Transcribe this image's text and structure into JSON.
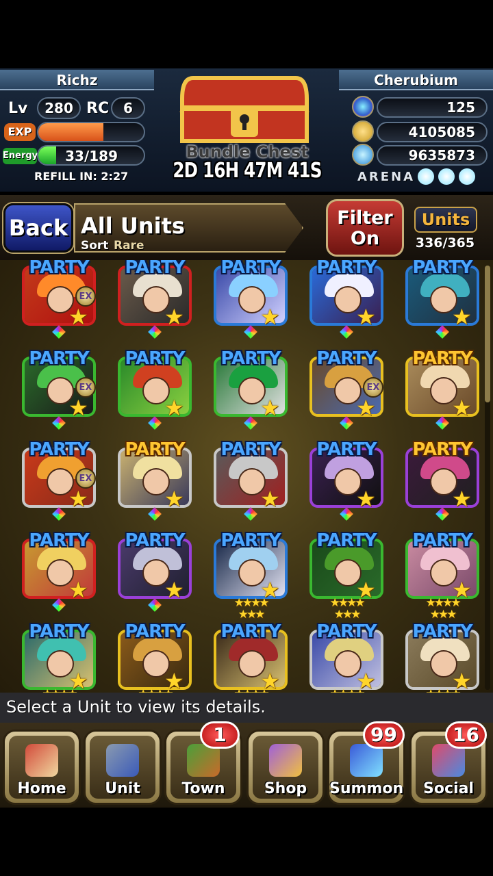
{
  "player": {
    "name": "Richz",
    "lv_label": "Lv",
    "level": "280",
    "rc_label": "RC",
    "rc": "6",
    "exp_label": "EXP",
    "exp_fraction": 0.62,
    "energy_label": "Energy",
    "energy": "33/189",
    "energy_fraction": 0.17,
    "refill": "REFILL IN: 2:27"
  },
  "rival": {
    "name": "Cherubium"
  },
  "currency": {
    "gems": "125",
    "zel": "4105085",
    "karma": "9635873",
    "arena_label": "ARENA",
    "arena_orbs": 3
  },
  "chest": {
    "label": "Bundle Chest",
    "timer": "2D 16H 47M 41S"
  },
  "toolbar": {
    "back": "Back",
    "title": "All Units",
    "sort_label": "Sort",
    "sort_value": "Rare",
    "filter_line1": "Filter",
    "filter_line2": "On",
    "units_label": "Units",
    "units_count": "336/365"
  },
  "grid": {
    "party_label": "PARTY",
    "units": [
      {
        "party": "blue",
        "frame": "#d02020",
        "ex": true,
        "gem": true,
        "palette": [
          "#c23a1a",
          "#ff8a2a",
          "#b01010"
        ]
      },
      {
        "party": "blue",
        "frame": "#d02020",
        "ex": false,
        "gem": true,
        "palette": [
          "#6a5a4a",
          "#e8e0d0",
          "#2a2a2a"
        ]
      },
      {
        "party": "blue",
        "frame": "#2a7ad8",
        "ex": false,
        "gem": true,
        "palette": [
          "#3a4aa8",
          "#8ad0ff",
          "#d0d0ff"
        ]
      },
      {
        "party": "blue",
        "frame": "#2a7ad8",
        "ex": false,
        "gem": true,
        "palette": [
          "#2a6ad8",
          "#f0f0ff",
          "#3a2050"
        ]
      },
      {
        "party": "blue",
        "frame": "#2a7ad8",
        "ex": false,
        "gem": true,
        "palette": [
          "#1a5a7a",
          "#40b0c0",
          "#203040"
        ]
      },
      {
        "party": "blue",
        "frame": "#3ab830",
        "ex": true,
        "gem": true,
        "palette": [
          "#2a6a2a",
          "#4ac04a",
          "#1a1a1a"
        ]
      },
      {
        "party": "blue",
        "frame": "#3ab830",
        "ex": false,
        "gem": true,
        "palette": [
          "#2a8a2a",
          "#d04020",
          "#8ad040"
        ]
      },
      {
        "party": "blue",
        "frame": "#3ab830",
        "ex": false,
        "gem": true,
        "palette": [
          "#2a7a3a",
          "#1aa040",
          "#e0e0e0"
        ]
      },
      {
        "party": "blue",
        "frame": "#e8c020",
        "ex": true,
        "gem": true,
        "palette": [
          "#6a4a2a",
          "#d8a040",
          "#4a6ab0"
        ]
      },
      {
        "party": "gold",
        "frame": "#e8c020",
        "ex": false,
        "gem": true,
        "palette": [
          "#a88a5a",
          "#f0d8b0",
          "#6a4a2a"
        ]
      },
      {
        "party": "blue",
        "frame": "#c8c8c8",
        "ex": true,
        "gem": true,
        "palette": [
          "#c83a1a",
          "#f0a030",
          "#8a2a1a"
        ]
      },
      {
        "party": "gold",
        "frame": "#c8c8c8",
        "ex": false,
        "gem": true,
        "palette": [
          "#c8b070",
          "#f0e0a0",
          "#3a3a5a"
        ]
      },
      {
        "party": "blue",
        "frame": "#c8c8c8",
        "ex": false,
        "gem": true,
        "palette": [
          "#5a5a5a",
          "#c8c8c8",
          "#a02020"
        ]
      },
      {
        "party": "blue",
        "frame": "#9a40d8",
        "ex": false,
        "gem": true,
        "palette": [
          "#3a2050",
          "#c0a0e0",
          "#101010"
        ]
      },
      {
        "party": "gold",
        "frame": "#9a40d8",
        "ex": false,
        "gem": true,
        "palette": [
          "#3a1a3a",
          "#d04a8a",
          "#202020"
        ]
      },
      {
        "party": "blue",
        "frame": "#d02020",
        "ex": false,
        "gem": true,
        "palette": [
          "#c89a30",
          "#f0d060",
          "#c03a3a"
        ]
      },
      {
        "party": "blue",
        "frame": "#9a40d8",
        "ex": false,
        "gem": true,
        "palette": [
          "#4a3a6a",
          "#c0c0d8",
          "#202030"
        ]
      },
      {
        "party": "blue",
        "frame": "#2a7ad8",
        "ex": false,
        "gem": false,
        "palette": [
          "#1a2a4a",
          "#a0d0f0",
          "#e0e0f0"
        ]
      },
      {
        "party": "blue",
        "frame": "#3ab830",
        "ex": false,
        "gem": false,
        "palette": [
          "#1a4a1a",
          "#4a9a2a",
          "#2a6a2a"
        ]
      },
      {
        "party": "blue",
        "frame": "#3ab830",
        "ex": false,
        "gem": false,
        "palette": [
          "#c88aa0",
          "#f0c0d0",
          "#7a4a6a"
        ]
      },
      {
        "party": "blue",
        "frame": "#3ab830",
        "ex": false,
        "gem": false,
        "palette": [
          "#2a6a6a",
          "#40c0b0",
          "#d8c070"
        ]
      },
      {
        "party": "blue",
        "frame": "#e8c020",
        "ex": false,
        "gem": false,
        "palette": [
          "#8a5a1a",
          "#d8a040",
          "#3a2a10"
        ]
      },
      {
        "party": "blue",
        "frame": "#e8c020",
        "ex": false,
        "gem": false,
        "palette": [
          "#3a2a1a",
          "#a02a2a",
          "#d8c070"
        ]
      },
      {
        "party": "blue",
        "frame": "#c8c8c8",
        "ex": false,
        "gem": false,
        "palette": [
          "#3a4aa8",
          "#e0d080",
          "#c0c0e0"
        ]
      },
      {
        "party": "blue",
        "frame": "#c8c8c8",
        "ex": false,
        "gem": false,
        "palette": [
          "#8a7a5a",
          "#f0e0c0",
          "#5a4a2a"
        ]
      }
    ],
    "star_rows": [
      0,
      0,
      0,
      3,
      3
    ]
  },
  "message": "Select a Unit to view its details.",
  "nav": [
    {
      "label": "Home",
      "badge": ""
    },
    {
      "label": "Unit",
      "badge": ""
    },
    {
      "label": "Town",
      "badge": "1"
    },
    {
      "label": "Shop",
      "badge": ""
    },
    {
      "label": "Summon",
      "badge": "99"
    },
    {
      "label": "Social",
      "badge": "16"
    }
  ]
}
